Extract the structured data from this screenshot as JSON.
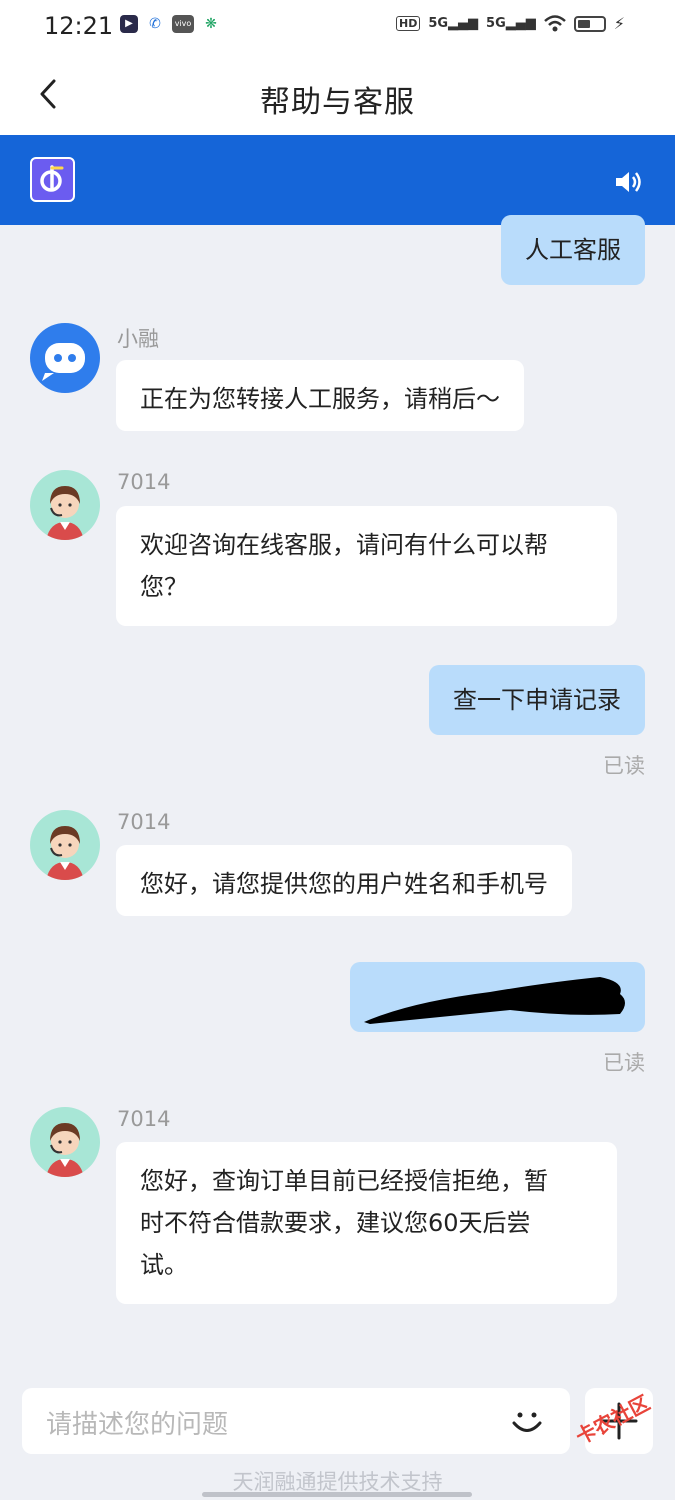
{
  "status_bar": {
    "time": "12:21",
    "net1": "5G",
    "net2": "5G",
    "hd": "HD"
  },
  "nav": {
    "title": "帮助与客服"
  },
  "messages": {
    "m1_text": "人工客服",
    "m2_sender": "小融",
    "m2_text": "正在为您转接人工服务，请稍后～",
    "m3_sender": "7014",
    "m3_line1": "欢迎咨询在线客服，请问有什么可以帮",
    "m3_line2": "您？",
    "m4_text": "查一下申请记录",
    "m4_status": "已读",
    "m5_sender": "7014",
    "m5_text": "您好，请您提供您的用户姓名和手机号",
    "m6_status": "已读",
    "m7_sender": "7014",
    "m7_line1": "您好，查询订单目前已经授信拒绝，暂",
    "m7_line2": "时不符合借款要求，建议您60天后尝",
    "m7_line3": "试。"
  },
  "input": {
    "placeholder": "请描述您的问题"
  },
  "footer": {
    "text": "天润融通提供技术支持"
  },
  "watermark": {
    "text": "卡农社区"
  },
  "colors": {
    "accent": "#1565d8",
    "bubble_out": "#b9dcfb",
    "background": "#eef0f5"
  }
}
